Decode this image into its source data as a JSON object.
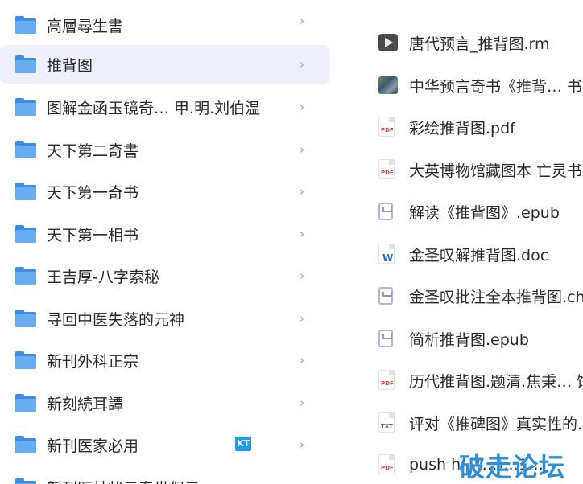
{
  "folders": [
    {
      "label": "高層尋生書"
    },
    {
      "label": "推背图",
      "selected": true
    },
    {
      "label": "图解金函玉镜奇…  甲.明.刘伯温"
    },
    {
      "label": "天下第二奇書"
    },
    {
      "label": "天下第一奇书"
    },
    {
      "label": "天下第一相书"
    },
    {
      "label": "王吉厚-八字索秘"
    },
    {
      "label": "寻回中医失落的元神"
    },
    {
      "label": "新刊外科正宗"
    },
    {
      "label": "新刻続耳譚"
    },
    {
      "label": "新刊医家必用",
      "badge": "KT"
    },
    {
      "label": "新刊医林状元寿世保元"
    }
  ],
  "chevron": "›",
  "files": [
    {
      "label": "唐代预言_推背图.rm",
      "icon": "video-file-icon",
      "type": "video"
    },
    {
      "label": "中华预言奇书《推背… 书",
      "icon": "image-file-icon",
      "type": "image"
    },
    {
      "label": "彩绘推背图.pdf",
      "icon": "pdf-file-icon",
      "type": "pdf",
      "tag": "PDF"
    },
    {
      "label": "大英博物馆藏图本 亡灵书",
      "icon": "pdf-file-icon",
      "type": "pdf",
      "tag": "PDF"
    },
    {
      "label": "解读《推背图》.epub",
      "icon": "epub-file-icon",
      "type": "epub"
    },
    {
      "label": "金圣叹解推背图.doc",
      "icon": "word-file-icon",
      "type": "doc",
      "tag": "W"
    },
    {
      "label": "金圣叹批注全本推背图.chm",
      "icon": "epub-file-icon",
      "type": "epub"
    },
    {
      "label": "简析推背图.epub",
      "icon": "epub-file-icon",
      "type": "epub"
    },
    {
      "label": "历代推背图.题清.焦秉… 馆",
      "icon": "pdf-file-icon",
      "type": "pdf",
      "tag": "PDF"
    },
    {
      "label": "评对《推碑图》真实性的…",
      "icon": "txt-file-icon",
      "type": "txt",
      "tag": "TXT"
    },
    {
      "label": "push h…(…)…1…",
      "icon": "pdf-file-icon",
      "type": "pdf",
      "tag": "PDF"
    }
  ],
  "watermark": "破走论坛",
  "colors": {
    "selected_bg": "#eef1fb",
    "folder_blue": "#3d8de6",
    "watermark": "#2c8fd8"
  }
}
